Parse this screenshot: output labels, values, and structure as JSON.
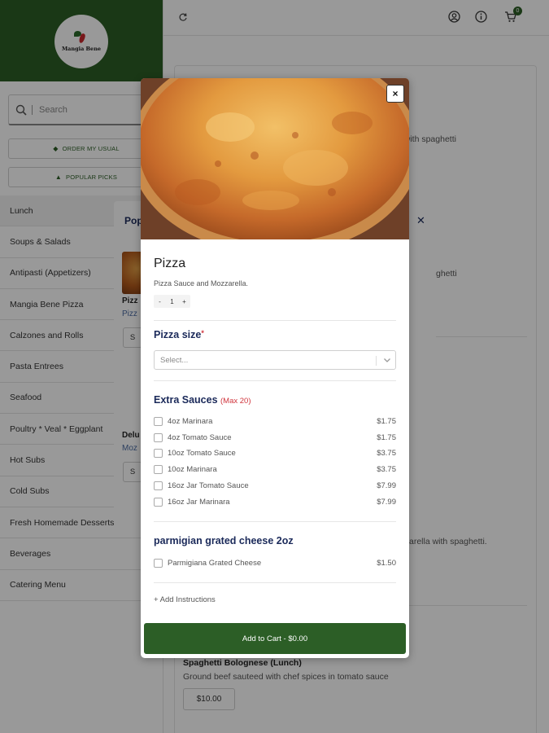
{
  "brand": {
    "name": "Mangia Bene"
  },
  "search": {
    "placeholder": "Search"
  },
  "sidebar": {
    "order_usual_label": "ORDER MY USUAL",
    "popular_picks_label": "POPULAR PICKS",
    "categories": [
      {
        "label": "Lunch"
      },
      {
        "label": "Soups & Salads"
      },
      {
        "label": "Antipasti (Appetizers)"
      },
      {
        "label": "Mangia Bene Pizza"
      },
      {
        "label": "Calzones and Rolls"
      },
      {
        "label": "Pasta Entrees"
      },
      {
        "label": "Seafood"
      },
      {
        "label": "Poultry * Veal * Eggplant"
      },
      {
        "label": "Hot Subs"
      },
      {
        "label": "Cold Subs"
      },
      {
        "label": "Fresh Homemade Desserts"
      },
      {
        "label": "Beverages"
      },
      {
        "label": "Catering Menu"
      }
    ]
  },
  "header": {
    "cart_count": "0"
  },
  "background": {
    "snippet_1": "o with spaghetti",
    "snippet_2": "ghetti",
    "snippet_3": "arella with spaghetti.",
    "item_title": "Spaghetti Bolognese (Lunch)",
    "item_desc": "Ground beef sauteed with chef spices in tomato sauce",
    "item_price": "$10.00"
  },
  "popular_modal": {
    "title": "Pop",
    "item1_name": "Pizz",
    "item1_desc": "Pizz",
    "item1_btn": "S",
    "item2_name": "Delu",
    "item2_desc": "Moz",
    "item2_btn": "S"
  },
  "product": {
    "name": "Pizza",
    "description": "Pizza Sauce and Mozzarella.",
    "quantity": {
      "minus": "-",
      "value": "1",
      "plus": "+"
    },
    "size": {
      "title": "Pizza size",
      "required_mark": "*",
      "placeholder": "Select..."
    },
    "extra_sauces": {
      "title": "Extra Sauces",
      "max_note": "(Max 20)",
      "options": [
        {
          "label": "4oz Marinara",
          "price": "$1.75"
        },
        {
          "label": "4oz Tomato Sauce",
          "price": "$1.75"
        },
        {
          "label": "10oz Tomato Sauce",
          "price": "$3.75"
        },
        {
          "label": "10oz Marinara",
          "price": "$3.75"
        },
        {
          "label": "16oz Jar Tomato Sauce",
          "price": "$7.99"
        },
        {
          "label": "16oz Jar Marinara",
          "price": "$7.99"
        }
      ]
    },
    "parmigian": {
      "title": "parmigian grated cheese 2oz",
      "options": [
        {
          "label": "Parmigiana Grated Cheese",
          "price": "$1.50"
        }
      ]
    },
    "add_instructions": "+ Add Instructions",
    "add_to_cart": "Add to Cart - $0.00",
    "close_symbol": "×"
  },
  "colors": {
    "brand_green": "#2c5e26",
    "section_title_navy": "#1b2a5a",
    "required_red": "#d0343c"
  }
}
